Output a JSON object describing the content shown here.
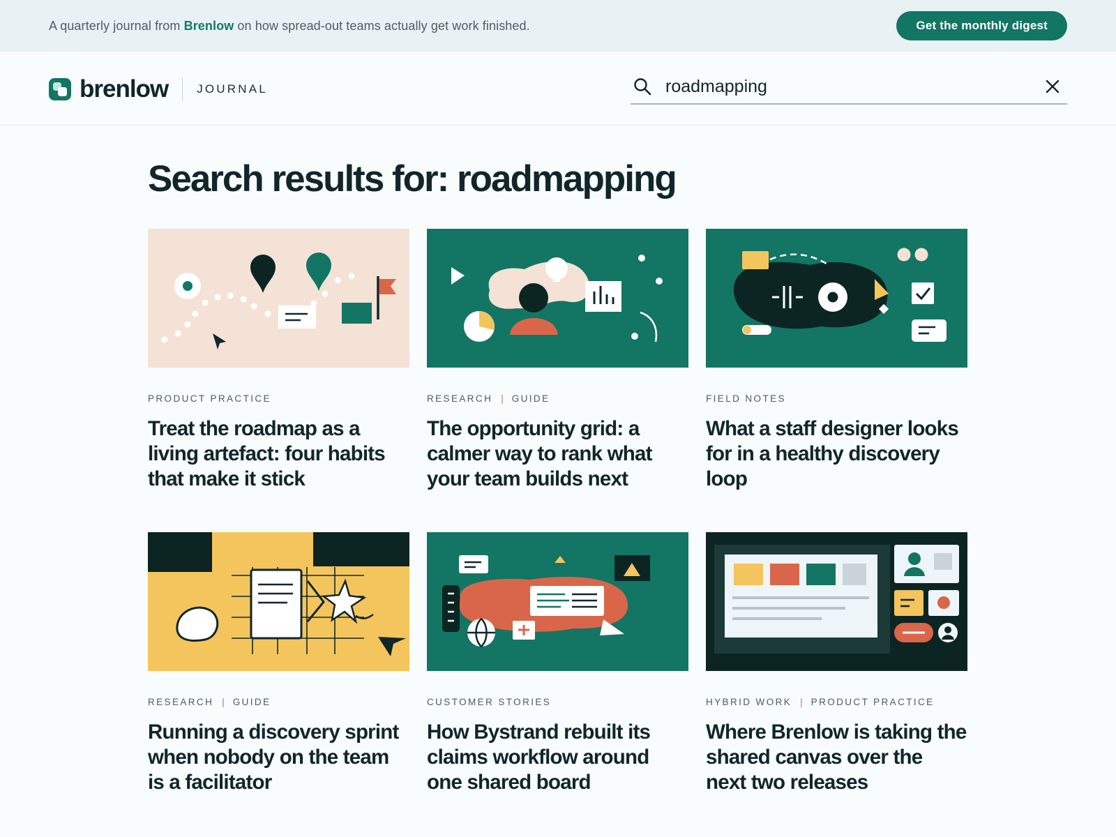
{
  "announcement": {
    "text_before": "A quarterly journal from ",
    "brand": "Brenlow",
    "text_after": " on how spread-out teams actually get work finished.",
    "cta_label": "Get the monthly digest"
  },
  "header": {
    "logo_word": "brenlow",
    "section_label": "JOURNAL",
    "search": {
      "value": "roadmapping",
      "icon": "search-icon",
      "clear_icon": "close-icon"
    }
  },
  "main": {
    "heading": "Search results for: roadmapping",
    "cards": [
      {
        "tags": [
          "PRODUCT PRACTICE"
        ],
        "title": "Treat the roadmap as a living artefact: four habits that make it stick"
      },
      {
        "tags": [
          "RESEARCH",
          "GUIDE"
        ],
        "title": "The opportunity grid: a calmer way to rank what your team builds next"
      },
      {
        "tags": [
          "FIELD NOTES"
        ],
        "title": "What a staff designer looks for in a healthy discovery loop"
      },
      {
        "tags": [
          "RESEARCH",
          "GUIDE"
        ],
        "title": "Running a discovery sprint when nobody on the team is a facilitator"
      },
      {
        "tags": [
          "CUSTOMER STORIES"
        ],
        "title": "How Bystrand rebuilt its claims workflow around one shared board"
      },
      {
        "tags": [
          "HYBRID WORK",
          "PRODUCT PRACTICE"
        ],
        "title": "Where Brenlow is taking the shared canvas over the next two releases"
      }
    ]
  },
  "colors": {
    "brand_green": "#137563",
    "ink": "#10262a",
    "accent_orange": "#d9664a",
    "accent_yellow": "#f4c55c",
    "blush": "#f4e2d6"
  }
}
